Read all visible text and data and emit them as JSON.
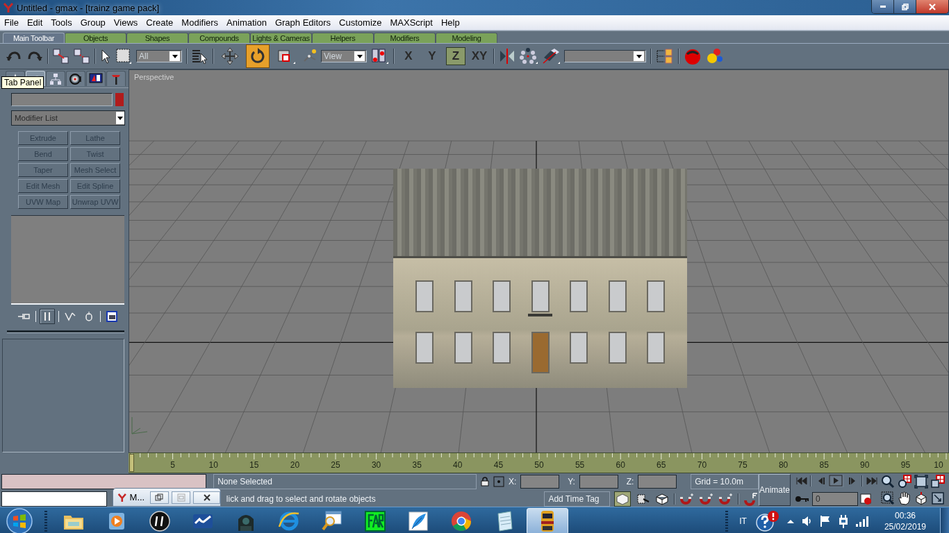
{
  "window": {
    "title": "Untitled - gmax - [trainz game pack]"
  },
  "menu": [
    "File",
    "Edit",
    "Tools",
    "Group",
    "Views",
    "Create",
    "Modifiers",
    "Animation",
    "Graph Editors",
    "Customize",
    "MAXScript",
    "Help"
  ],
  "tabs": [
    {
      "label": "Main Toolbar",
      "selected": true
    },
    {
      "label": "Objects",
      "selected": false
    },
    {
      "label": "Shapes",
      "selected": false
    },
    {
      "label": "Compounds",
      "selected": false
    },
    {
      "label": "Lights & Cameras",
      "selected": false
    },
    {
      "label": "Helpers",
      "selected": false
    },
    {
      "label": "Modifiers",
      "selected": false
    },
    {
      "label": "Modeling",
      "selected": false
    }
  ],
  "toolbar": {
    "selection_filter": "All",
    "transform_tools": [
      {
        "selected": false
      },
      {
        "selected": true
      },
      {
        "selected": false
      }
    ],
    "reference_coordinates": "View",
    "axes": [
      {
        "label": "X",
        "selected": false
      },
      {
        "label": "Y",
        "selected": false
      },
      {
        "label": "Z",
        "selected": true
      },
      {
        "label": "XY",
        "selected": false
      }
    ]
  },
  "command_panel": {
    "tabs": [
      {
        "selected": false
      },
      {
        "selected": true
      },
      {
        "selected": false
      },
      {
        "selected": false
      },
      {
        "selected": false
      },
      {
        "selected": false
      }
    ],
    "tooltip": "Tab Panel",
    "modifier_list": "Modifier List",
    "modifier_buttons": [
      "Extrude",
      "Lathe",
      "Bend",
      "Twist",
      "Taper",
      "Mesh Select",
      "Edit Mesh",
      "Edit Spline",
      "UVW Map",
      "Unwrap UVW"
    ],
    "stack_tools": [
      {
        "selected": false
      },
      {
        "selected": true
      },
      {
        "selected": false
      },
      {
        "selected": false
      },
      {
        "selected": false
      }
    ]
  },
  "viewport": {
    "label": "Perspective"
  },
  "time_slider": {
    "labels": [
      "5",
      "10",
      "15",
      "20",
      "25",
      "30",
      "35",
      "40",
      "45",
      "50",
      "55",
      "60",
      "65",
      "70",
      "75",
      "80",
      "85",
      "90",
      "95",
      "10"
    ]
  },
  "status": {
    "selection": "None Selected",
    "prompt": "lick and drag to select and rotate objects",
    "coordinates": [
      "X:",
      "Y:",
      "Z:"
    ],
    "grid": "Grid = 10.0m",
    "time_tag": "Add Time Tag",
    "animate": "Animate",
    "frame": "0"
  },
  "minimized_window": {
    "title": "M..."
  },
  "taskbar": {
    "apps": [
      {
        "selected": false
      },
      {
        "selected": false
      },
      {
        "selected": false
      },
      {
        "selected": false
      },
      {
        "selected": false
      },
      {
        "selected": false
      },
      {
        "selected": false
      },
      {
        "selected": false
      },
      {
        "selected": false
      },
      {
        "selected": false
      },
      {
        "selected": false
      },
      {
        "selected": true
      }
    ],
    "language": "IT",
    "time": "00:36",
    "date": "25/02/2019"
  }
}
